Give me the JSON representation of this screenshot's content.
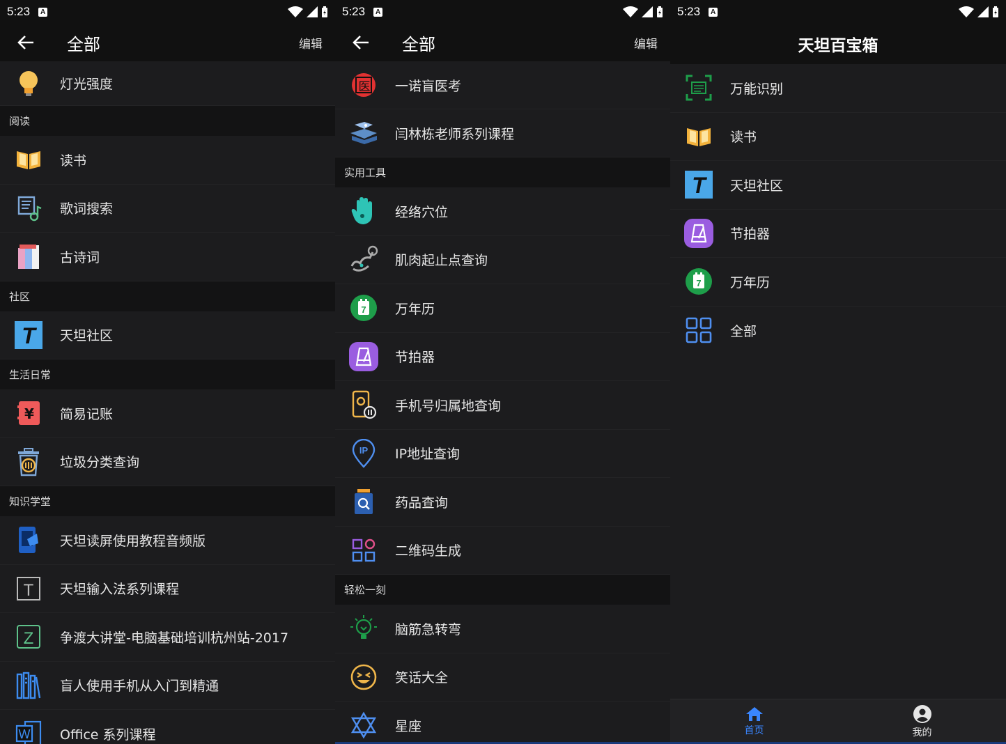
{
  "status": {
    "time": "5:23",
    "a_icon": "A"
  },
  "panel1": {
    "title": "全部",
    "edit": "编辑",
    "top_item": "灯光强度",
    "sections": [
      {
        "header": "阅读",
        "items": [
          "读书",
          "歌词搜索",
          "古诗词"
        ]
      },
      {
        "header": "社区",
        "items": [
          "天坦社区"
        ]
      },
      {
        "header": "生活日常",
        "items": [
          "简易记账",
          "垃圾分类查询"
        ]
      },
      {
        "header": "知识学堂",
        "items": [
          "天坦读屏使用教程音频版",
          "天坦输入法系列课程",
          "争渡大讲堂-电脑基础培训杭州站-2017",
          "盲人使用手机从入门到精通",
          "Office 系列课程"
        ]
      }
    ]
  },
  "panel2": {
    "title": "全部",
    "edit": "编辑",
    "top_items": [
      "一诺盲医考",
      "闫林栋老师系列课程"
    ],
    "sections": [
      {
        "header": "实用工具",
        "items": [
          "经络穴位",
          "肌肉起止点查询",
          "万年历",
          "节拍器",
          "手机号归属地查询",
          "IP地址查询",
          "药品查询",
          "二维码生成"
        ]
      },
      {
        "header": "轻松一刻",
        "items": [
          "脑筋急转弯",
          "笑话大全",
          "星座"
        ]
      }
    ]
  },
  "panel3": {
    "title": "天坦百宝箱",
    "items": [
      "万能识别",
      "读书",
      "天坦社区",
      "节拍器",
      "万年历",
      "全部"
    ],
    "nav": {
      "home": "首页",
      "mine": "我的"
    }
  },
  "icon_glyphs": {
    "medical": "医",
    "calendar_day": "7",
    "money": "¥",
    "tiantan": "T",
    "input_t": "T",
    "z_letter": "Z",
    "ip": "IP",
    "office": "W"
  },
  "colors": {
    "accent": "#3a86ff",
    "bg": "#1c1c1e",
    "section_bg": "#131314"
  }
}
